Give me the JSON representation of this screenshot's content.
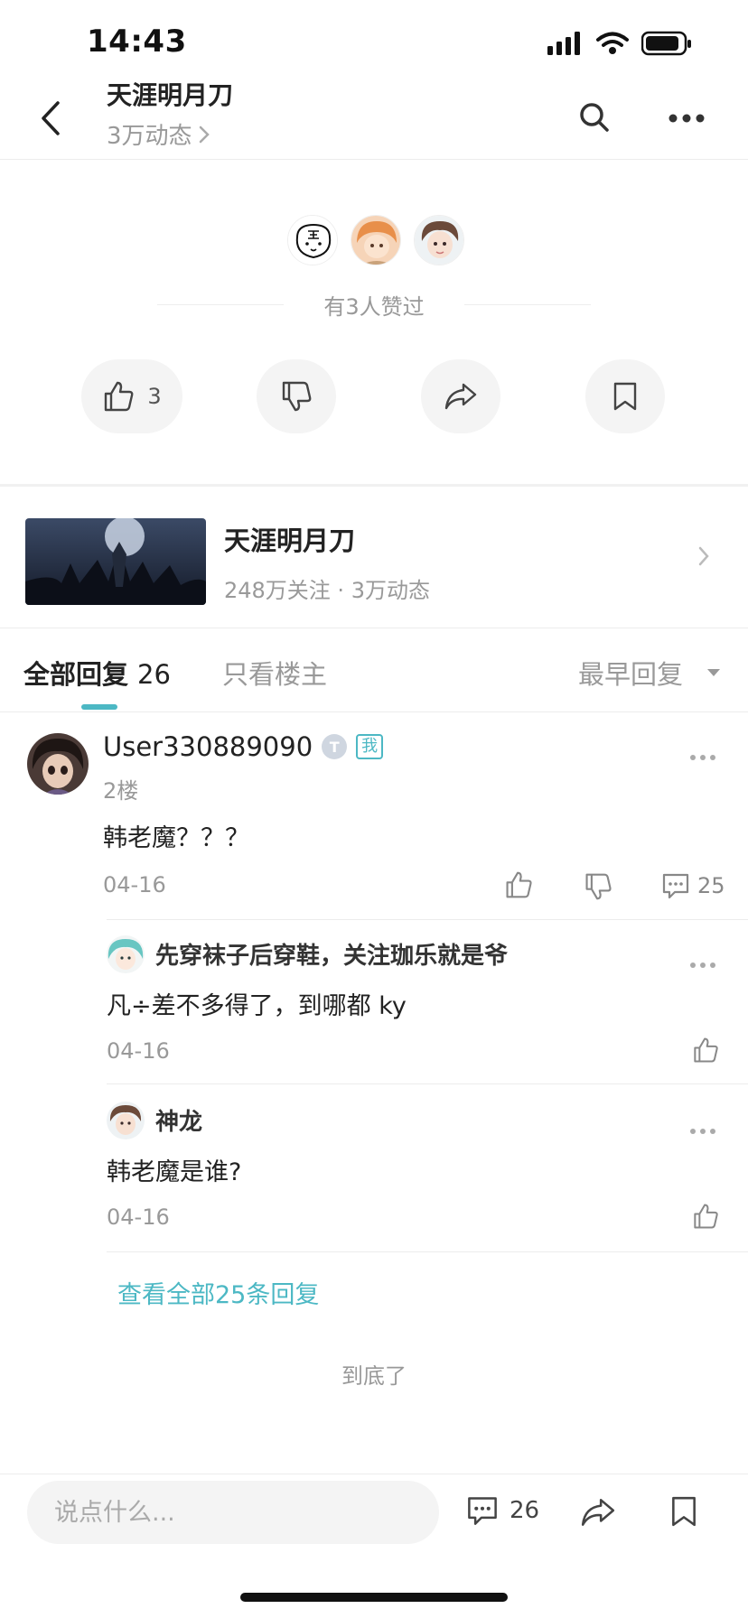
{
  "status": {
    "time": "14:43"
  },
  "nav": {
    "title": "天涯明月刀",
    "subtitle": "3万动态"
  },
  "likes": {
    "avatars": [
      "avatar-tiger",
      "avatar-orange-hair",
      "avatar-boy"
    ],
    "text": "有3人赞过",
    "like_count": "3"
  },
  "forum": {
    "name": "天涯明月刀",
    "meta": "248万关注 · 3万动态"
  },
  "tabs": {
    "all_label": "全部回复",
    "all_count": "26",
    "owner_label": "只看楼主",
    "sort_label": "最早回复"
  },
  "comment": {
    "user": "User330889090",
    "badge_t": "T",
    "badge_me": "我",
    "floor": "2楼",
    "text": "韩老魔？？？",
    "date": "04-16",
    "reply_count": "25"
  },
  "replies": [
    {
      "name": "先穿袜子后穿鞋，关注珈乐就是爷",
      "text": "凡÷差不多得了，到哪都 ky",
      "date": "04-16"
    },
    {
      "name": "神龙",
      "text": "韩老魔是谁?",
      "date": "04-16"
    }
  ],
  "view_all": "查看全部25条回复",
  "end_text": "到底了",
  "bottom": {
    "placeholder": "说点什么...",
    "comment_count": "26"
  },
  "colors": {
    "accent": "#4cb8c4",
    "muted": "#999999",
    "text": "#222222",
    "pill_bg": "#f4f4f4"
  }
}
